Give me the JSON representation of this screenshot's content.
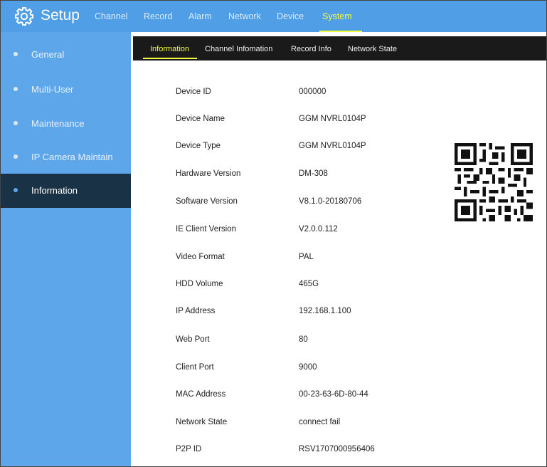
{
  "header": {
    "title": "Setup",
    "nav": [
      "Channel",
      "Record",
      "Alarm",
      "Network",
      "Device",
      "System"
    ],
    "active_nav": "System",
    "colors": {
      "bar": "#4f9ee6",
      "active": "#f1ff3a"
    }
  },
  "sidebar": {
    "items": [
      "General",
      "Multi-User",
      "Maintenance",
      "IP Camera Maintain",
      "Information"
    ],
    "active": "Information"
  },
  "tabs": {
    "items": [
      "Information",
      "Channel Infomation",
      "Record Info",
      "Network State"
    ],
    "active": "Information"
  },
  "info": {
    "rows": [
      {
        "label": "Device ID",
        "value": "000000"
      },
      {
        "label": "Device Name",
        "value": "GGM NVRL0104P"
      },
      {
        "label": "Device Type",
        "value": "GGM NVRL0104P"
      },
      {
        "label": "Hardware Version",
        "value": "DM-308"
      },
      {
        "label": "Software Version",
        "value": "V8.1.0-20180706"
      },
      {
        "label": "IE Client Version",
        "value": "V2.0.0.112"
      },
      {
        "label": "Video Format",
        "value": "PAL"
      },
      {
        "label": "HDD Volume",
        "value": "465G"
      },
      {
        "label": "IP Address",
        "value": "192.168.1.100"
      },
      {
        "label": "Web Port",
        "value": "80"
      },
      {
        "label": "Client Port",
        "value": "9000"
      },
      {
        "label": "MAC Address",
        "value": "00-23-63-6D-80-44"
      },
      {
        "label": "Network State",
        "value": "connect fail"
      },
      {
        "label": "P2P ID",
        "value": "RSV1707000956406"
      }
    ]
  },
  "icons": {
    "settings": "gear-icon",
    "qr": "qr-code-icon",
    "bullet": "bullet-dot-icon"
  }
}
